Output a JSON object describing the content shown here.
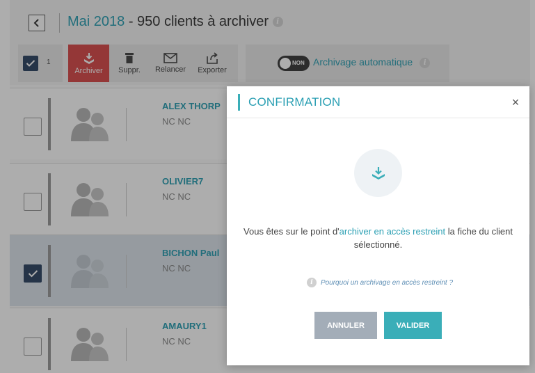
{
  "header": {
    "title_accent": "Mai 2018",
    "title_rest": " - 950 clients à archiver",
    "info_glyph": "i"
  },
  "toolbar": {
    "selected_count": "1",
    "archive_label": "Archiver",
    "delete_label": "Suppr.",
    "remind_label": "Relancer",
    "export_label": "Exporter",
    "toggle_state": "NON",
    "auto_archive_label": "Archivage automatique",
    "info_glyph": "i"
  },
  "clients": [
    {
      "name": "ALEX THORP",
      "detail": "NC NC",
      "selected": false
    },
    {
      "name": "OLIVIER7",
      "detail": "NC NC",
      "selected": false
    },
    {
      "name": "BICHON Paul",
      "detail": "NC NC",
      "selected": true
    },
    {
      "name": "AMAURY1",
      "detail": "NC NC",
      "selected": false
    }
  ],
  "modal": {
    "title": "CONFIRMATION",
    "close_glyph": "×",
    "message_before": "Vous êtes sur le point d'",
    "message_link": "archiver en accès restreint",
    "message_after": " la fiche du client sélectionné.",
    "why_glyph": "i",
    "why_text": "Pourquoi un archivage en accès restreint ?",
    "cancel_label": "ANNULER",
    "confirm_label": "VALIDER"
  },
  "colors": {
    "accent": "#2a9fb3",
    "teal_button": "#3aaeb8",
    "danger": "#d94a4a",
    "navy": "#2f4565",
    "muted_button": "#a3adb8"
  },
  "icons": {
    "back": "chevron-left-icon",
    "archive": "archive-download-icon",
    "delete": "trash-icon",
    "remind": "envelope-icon",
    "export": "export-icon",
    "avatar": "user-group-icon",
    "check": "check-icon",
    "close": "close-icon",
    "info": "info-icon"
  }
}
